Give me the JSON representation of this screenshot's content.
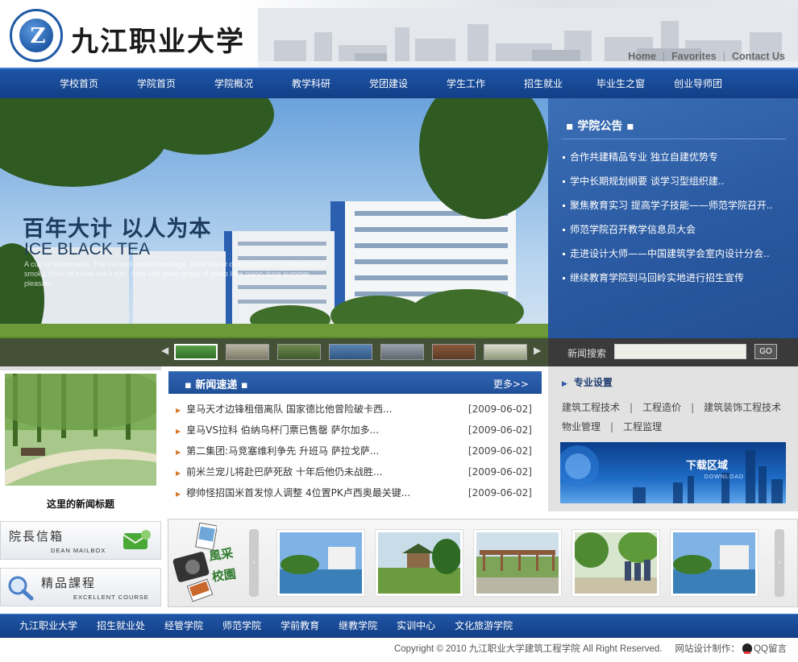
{
  "header": {
    "logo_text": "九江职业大学",
    "logo_emblem_letter": "Z",
    "top_links": [
      "Home",
      "Favorites",
      "Contact Us"
    ]
  },
  "nav": {
    "items": [
      "学校首页",
      "学院首页",
      "学院概况",
      "教学科研",
      "党团建设",
      "学生工作",
      "招生就业",
      "毕业生之窗",
      "创业导师团"
    ]
  },
  "banner": {
    "title": "百年大计 以人为本",
    "subtitle": "ICE BLACK TEA",
    "description": "A cup of fashionable. The ice cool votive beverage, black tea or delicious plus the deepness of smoky, think he's kiss one's ruth. Stay and piano grape of piano love piano dune summer pleasant"
  },
  "notice": {
    "heading": "学院公告",
    "items": [
      "合作共建精品专业  独立自建优势专",
      "学中长期规划纲要  谈学习型组织建..",
      "聚焦教育实习  提高学子技能——师范学院召开..",
      "师范学院召开教学信息员大会",
      "走进设计大师——中国建筑学会室内设计分会..",
      "继续教育学院到马回岭实地进行招生宣传"
    ]
  },
  "search": {
    "label": "新闻搜索",
    "value": "",
    "go_label": "GO"
  },
  "news_photo": {
    "caption": "这里的新闻标题"
  },
  "news": {
    "heading": "新闻速递",
    "more_label": "更多>>",
    "items": [
      {
        "title": "皇马天才边锋租借离队 国家德比他曾险破卡西...",
        "date": "[2009-06-02]"
      },
      {
        "title": "皇马VS拉科 伯纳乌杯门票已售罄 萨尔加多...",
        "date": "[2009-06-02]"
      },
      {
        "title": "第二集团:马竞塞维利争先 升班马 萨拉戈萨...",
        "date": "[2009-06-02]"
      },
      {
        "title": "前米兰宠儿将赴巴萨死敌 十年后他仍未战胜...",
        "date": "[2009-06-02]"
      },
      {
        "title": "穆帅怪招国米首发惊人调整 4位置PK卢西奥最关键...",
        "date": "[2009-06-02]"
      }
    ]
  },
  "major": {
    "heading": "专业设置",
    "row1": [
      "建筑工程技术",
      "工程造价",
      "建筑装饰工程技术"
    ],
    "row2": [
      "物业管理",
      "工程监理"
    ],
    "download_title": "下载区域",
    "download_sub": "DOWNLOAD"
  },
  "side_buttons": [
    {
      "zh": "院長信箱",
      "en": "DEAN MAILBOX",
      "icon": "mail-envelope-icon"
    },
    {
      "zh": "精品課程",
      "en": "EXCELLENT COURSE",
      "icon": "magnifier-icon"
    }
  ],
  "gallery": {
    "logo_text": "風采校園",
    "photo_count": 5
  },
  "footer_nav": {
    "items": [
      "九江职业大学",
      "招生就业处",
      "经管学院",
      "师范学院",
      "学前教育",
      "继教学院",
      "实训中心",
      "文化旅游学院"
    ]
  },
  "footer": {
    "copyright": "Copyright © 2010 九江职业大学建筑工程学院 All Right Reserved.",
    "design_label": "网站设计制作：",
    "qq_label": "QQ留言"
  },
  "colors": {
    "nav_blue": "#1d54a6",
    "notice_blue": "#2b5ba3",
    "news_arrow": "#d6782c"
  }
}
